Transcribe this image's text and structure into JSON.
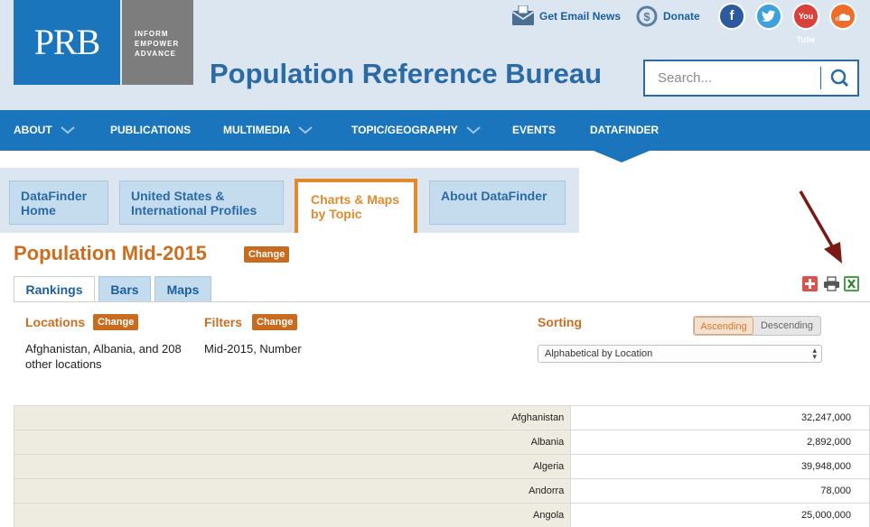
{
  "header": {
    "logo_text": "PRB",
    "logo_tagline": [
      "INFORM",
      "EMPOWER",
      "ADVANCE"
    ],
    "site_title": "Population Reference Bureau",
    "email_link": "Get Email News",
    "donate_link": "Donate",
    "social": [
      "facebook-icon",
      "twitter-icon",
      "youtube-icon",
      "soundcloud-icon"
    ],
    "youtube_label": "You Tube",
    "search_placeholder": "Search..."
  },
  "nav": {
    "items": [
      {
        "label": "ABOUT",
        "has_dropdown": true
      },
      {
        "label": "PUBLICATIONS",
        "has_dropdown": false
      },
      {
        "label": "MULTIMEDIA",
        "has_dropdown": true
      },
      {
        "label": "TOPIC/GEOGRAPHY",
        "has_dropdown": true
      },
      {
        "label": "EVENTS",
        "has_dropdown": false
      },
      {
        "label": "DATAFINDER",
        "has_dropdown": false
      }
    ],
    "active": "DATAFINDER"
  },
  "subtabs": [
    {
      "label": "DataFinder Home"
    },
    {
      "label": "United States & International Profiles"
    },
    {
      "label": "Charts & Maps by Topic",
      "active": true
    },
    {
      "label": "About DataFinder"
    }
  ],
  "page": {
    "title": "Population Mid-2015",
    "change_label": "Change"
  },
  "view_tabs": [
    {
      "label": "Rankings",
      "active": true
    },
    {
      "label": "Bars"
    },
    {
      "label": "Maps"
    }
  ],
  "options": {
    "locations_label": "Locations",
    "locations_value": "Afghanistan, Albania, and 208 other locations",
    "filters_label": "Filters",
    "filters_value": "Mid-2015, Number",
    "sorting_label": "Sorting",
    "sort_ascending": "Ascending",
    "sort_descending": "Descending",
    "sort_selected": "Alphabetical by Location"
  },
  "table": {
    "rows": [
      {
        "location": "Afghanistan",
        "value": "32,247,000"
      },
      {
        "location": "Albania",
        "value": "2,892,000"
      },
      {
        "location": "Algeria",
        "value": "39,948,000"
      },
      {
        "location": "Andorra",
        "value": "78,000"
      },
      {
        "location": "Angola",
        "value": "25,000,000"
      }
    ]
  },
  "colors": {
    "brand_blue": "#1a75bc",
    "accent_orange": "#c96b1e",
    "header_bg": "#dce6f0"
  }
}
